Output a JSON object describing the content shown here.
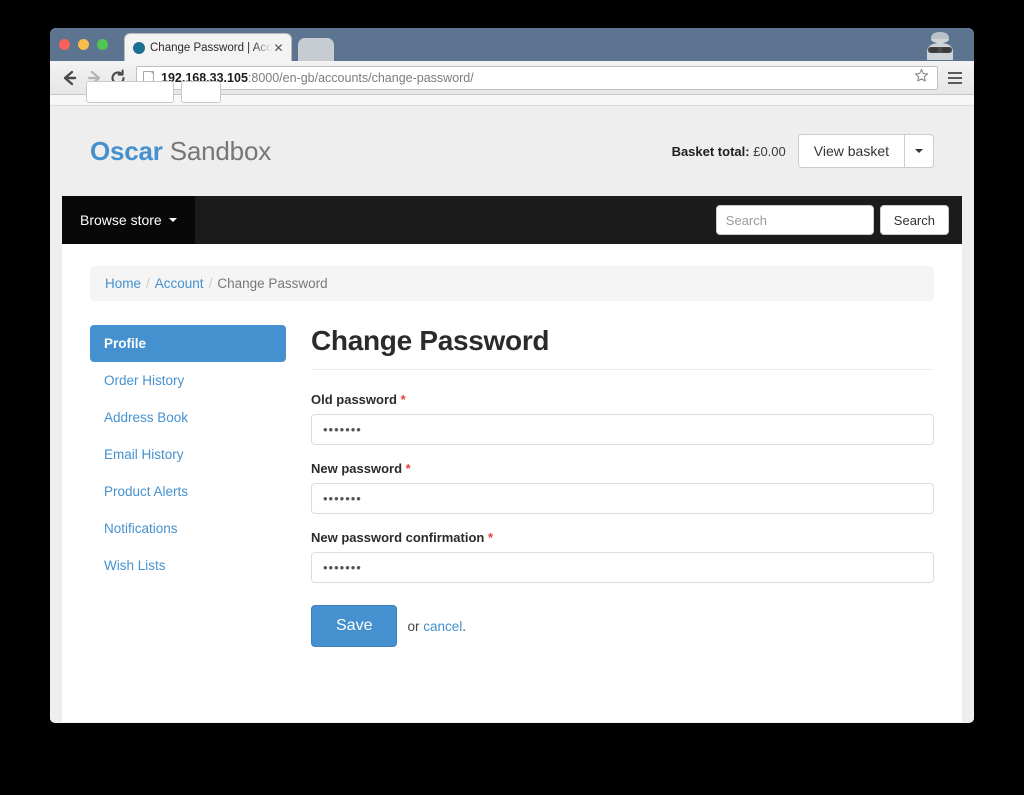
{
  "browser": {
    "tab": {
      "title": "Change Password | Accoun",
      "favicon": "globe-icon",
      "close_label": "✕"
    },
    "new_tab_label": "+",
    "toolbar": {
      "back_label": "←",
      "forward_label": "→",
      "reload_label": "↻",
      "url_host": "192.168.33.105",
      "url_path": ":8000/en-gb/accounts/change-password/",
      "star_label": "☆",
      "menu_label": "menu"
    }
  },
  "site": {
    "brand_strong": "Oscar",
    "brand_rest": " Sandbox",
    "basket": {
      "total_label": "Basket total:",
      "total_value": "£0.00",
      "view_basket_label": "View basket"
    },
    "nav": {
      "browse_store_label": "Browse store",
      "search_placeholder": "Search",
      "search_value": "",
      "search_button_label": "Search"
    }
  },
  "breadcrumb": {
    "home": "Home",
    "account": "Account",
    "current": "Change Password",
    "separator": "/"
  },
  "sidebar": {
    "items": [
      {
        "label": "Profile",
        "active": true
      },
      {
        "label": "Order History",
        "active": false
      },
      {
        "label": "Address Book",
        "active": false
      },
      {
        "label": "Email History",
        "active": false
      },
      {
        "label": "Product Alerts",
        "active": false
      },
      {
        "label": "Notifications",
        "active": false
      },
      {
        "label": "Wish Lists",
        "active": false
      }
    ]
  },
  "form": {
    "title": "Change Password",
    "required_marker": "*",
    "fields": [
      {
        "label": "Old password",
        "value": "•••••••"
      },
      {
        "label": "New password",
        "value": "•••••••"
      },
      {
        "label": "New password confirmation",
        "value": "•••••••"
      }
    ],
    "save_label": "Save",
    "or_text": "or ",
    "cancel_label": "cancel",
    "period": "."
  },
  "colors": {
    "accent_blue": "#4591cf",
    "required_red": "#e8403a",
    "navbar_black": "#1b1b1b",
    "titlebar": "#5c748f",
    "page_bg": "#eeeeee"
  }
}
